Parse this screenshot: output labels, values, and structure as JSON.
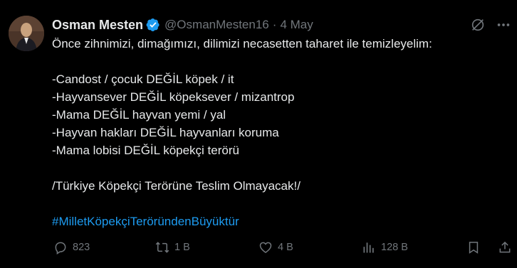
{
  "tweet": {
    "author_name": "Osman Mesten",
    "handle": "@OsmanMesten16",
    "separator": "·",
    "date": "4 May",
    "lines": {
      "l0": "Önce zihnimizi, dimağımızı, dilimizi necasetten taharet ile temizleyelim:",
      "l1": "-Candost / çocuk DEĞİL köpek / it",
      "l2": "-Hayvansever DEĞİL köpeksever / mizantrop",
      "l3": "-Mama DEĞİL hayvan yemi / yal",
      "l4": "-Hayvan hakları DEĞİL hayvanları koruma",
      "l5": "-Mama lobisi DEĞİL köpekçi terörü",
      "l6": "/Türkiye Köpekçi Terörüne Teslim Olmayacak!/",
      "hashtag": "#MilletKöpekçiTeröründenBüyüktür"
    }
  },
  "actions": {
    "replies": "823",
    "reposts": "1 B",
    "likes": "4 B",
    "views": "128 B"
  },
  "icons": {
    "verified": "verified-badge-icon",
    "grok": "grok-icon",
    "more": "more-icon",
    "reply": "reply-icon",
    "repost": "repost-icon",
    "like": "heart-icon",
    "views": "views-icon",
    "bookmark": "bookmark-icon",
    "share": "share-icon"
  },
  "colors": {
    "background": "#000000",
    "text": "#e7e9ea",
    "muted": "#71767b",
    "accent": "#1d9bf0"
  }
}
